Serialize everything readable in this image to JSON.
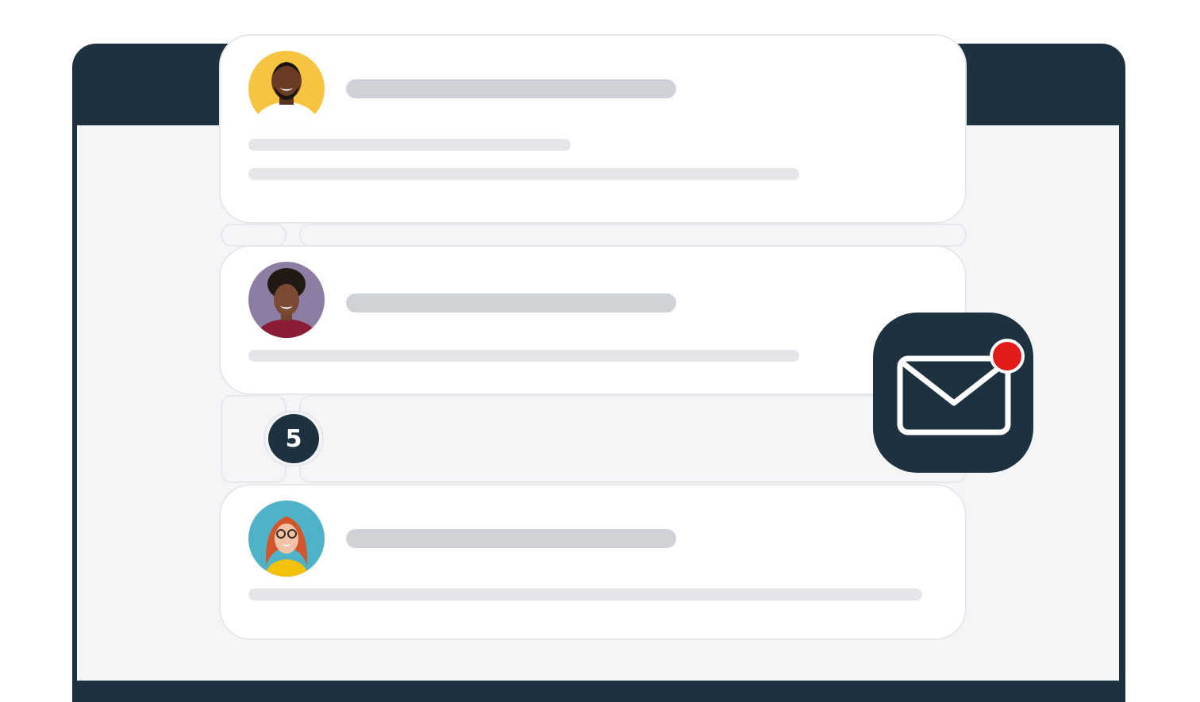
{
  "colors": {
    "window_frame": "#1e313f",
    "window_body": "#f4f5f7",
    "card_background": "#ffffff",
    "placeholder_title": "#cfd3d7",
    "placeholder_line": "#e3e5e8",
    "notification_dot": "#e21a1a"
  },
  "thread": {
    "messages": [
      {
        "avatar_icon": "avatar-man-yellow-background"
      },
      {
        "avatar_icon": "avatar-woman-purple-background"
      },
      {
        "avatar_icon": "avatar-woman-glasses-teal-background"
      }
    ],
    "collapsed_count": "5"
  },
  "mail_app": {
    "icon": "envelope-icon",
    "has_unread_dot": true
  }
}
